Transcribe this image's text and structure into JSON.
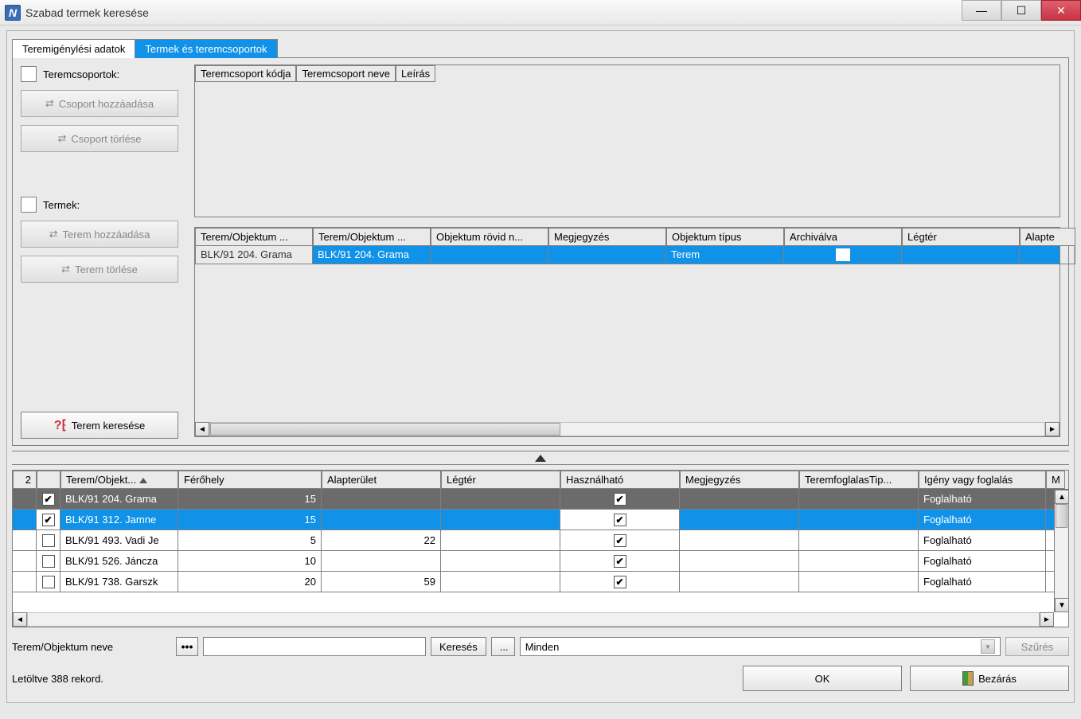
{
  "window": {
    "title": "Szabad termek keresése"
  },
  "tabs": {
    "t1": "Teremigénylési adatok",
    "t2": "Termek és teremcsoportok"
  },
  "groups": {
    "label": "Teremcsoportok:",
    "add": "Csoport hozzáadása",
    "del": "Csoport törlése",
    "columns": {
      "c1": "Teremcsoport kódja",
      "c2": "Teremcsoport neve",
      "c3": "Leírás"
    }
  },
  "rooms": {
    "label": "Termek:",
    "add": "Terem hozzáadása",
    "del": "Terem törlése",
    "search": "Terem keresése",
    "columns": {
      "c1": "Terem/Objektum ...",
      "c2": "Terem/Objektum ...",
      "c3": "Objektum rövid n...",
      "c4": "Megjegyzés",
      "c5": "Objektum típus",
      "c6": "Archiválva",
      "c7": "Légtér",
      "c8": "Alapte"
    },
    "row": {
      "c1": "BLK/91 204. Grama",
      "c2": "BLK/91 204. Grama",
      "c5": "Terem"
    }
  },
  "results": {
    "count": "2",
    "columns": {
      "c1": "Terem/Objekt...",
      "c2": "Férőhely",
      "c3": "Alapterület",
      "c4": "Légtér",
      "c5": "Használható",
      "c6": "Megjegyzés",
      "c7": "TeremfoglalasTip...",
      "c8": "Igény vagy foglalás",
      "c9": "M"
    },
    "rows": [
      {
        "checked": true,
        "name": "BLK/91 204. Grama",
        "cap": "15",
        "area": "",
        "booking": "Foglalható",
        "cls": "selected1"
      },
      {
        "checked": true,
        "name": "BLK/91 312. Jamne",
        "cap": "15",
        "area": "",
        "booking": "Foglalható",
        "cls": "selected2"
      },
      {
        "checked": false,
        "name": "BLK/91 493. Vadi Je",
        "cap": "5",
        "area": "22",
        "booking": "Foglalható",
        "cls": ""
      },
      {
        "checked": false,
        "name": "BLK/91 526. Jáncza",
        "cap": "10",
        "area": "",
        "booking": "Foglalható",
        "cls": ""
      },
      {
        "checked": false,
        "name": "BLK/91 738. Garszk",
        "cap": "20",
        "area": "59",
        "booking": "Foglalható",
        "cls": ""
      }
    ]
  },
  "search": {
    "field_label": "Terem/Objektum neve",
    "search_btn": "Keresés",
    "more_btn": "...",
    "combo_value": "Minden",
    "filter_btn": "Szűrés"
  },
  "footer": {
    "status": "Letöltve 388 rekord.",
    "ok": "OK",
    "close": "Bezárás"
  }
}
